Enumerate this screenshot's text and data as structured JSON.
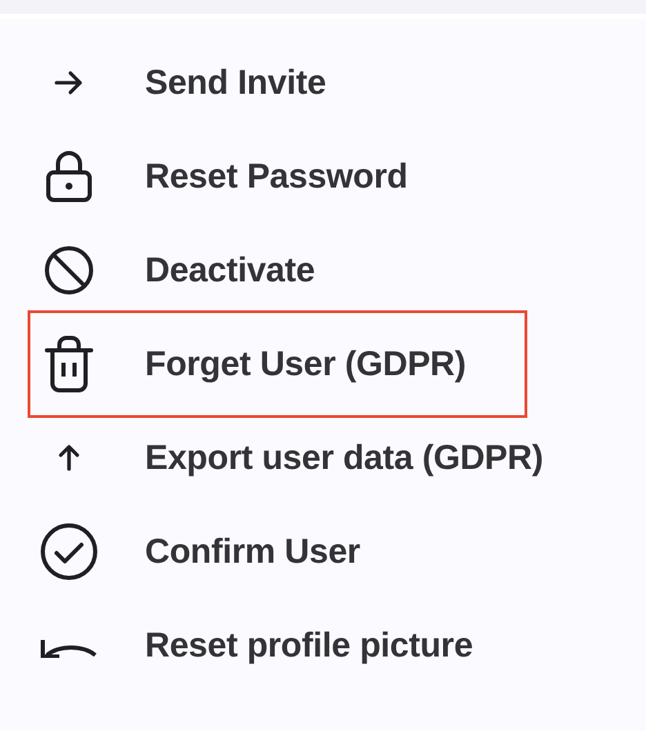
{
  "menu": {
    "items": [
      {
        "label": "Send Invite",
        "kind": "arrow-right",
        "highlighted": false
      },
      {
        "label": "Reset Password",
        "kind": "lock",
        "highlighted": false
      },
      {
        "label": "Deactivate",
        "kind": "ban",
        "highlighted": false
      },
      {
        "label": "Forget User (GDPR)",
        "kind": "trash",
        "highlighted": true
      },
      {
        "label": "Export user data (GDPR)",
        "kind": "arrow-up",
        "highlighted": false
      },
      {
        "label": "Confirm User",
        "kind": "check-circle",
        "highlighted": false
      },
      {
        "label": "Reset profile picture",
        "kind": "undo",
        "highlighted": false
      }
    ]
  }
}
